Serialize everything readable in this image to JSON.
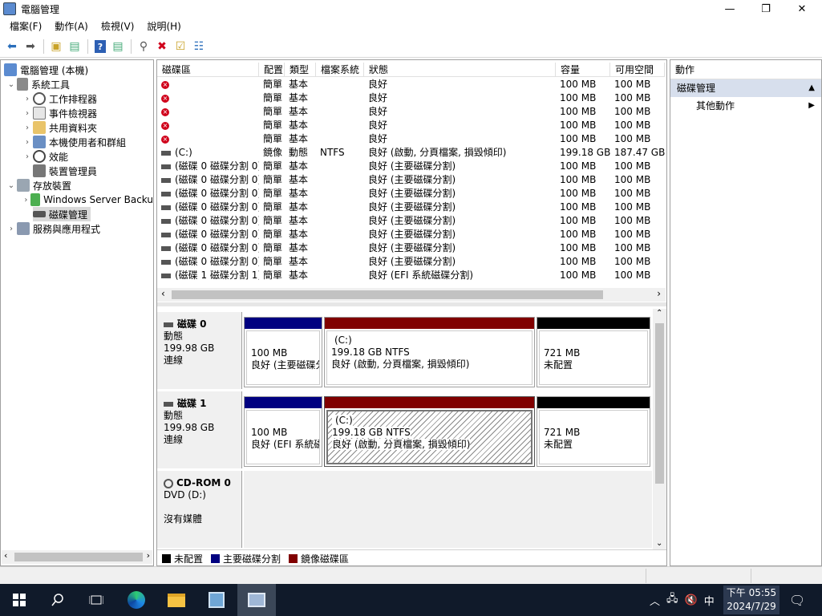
{
  "window": {
    "title": "電腦管理",
    "minimize": "—",
    "maximize": "❐",
    "close": "✕"
  },
  "menu": [
    "檔案(F)",
    "動作(A)",
    "檢視(V)",
    "說明(H)"
  ],
  "tree": {
    "root": "電腦管理 (本機)",
    "system_tools": "系統工具",
    "task_scheduler": "工作排程器",
    "event_viewer": "事件檢視器",
    "shared_folders": "共用資料夾",
    "local_users": "本機使用者和群組",
    "performance": "效能",
    "device_manager": "裝置管理員",
    "storage": "存放裝置",
    "windows_backup": "Windows Server Backu",
    "disk_management": "磁碟管理",
    "services": "服務與應用程式"
  },
  "columns": [
    "磁碟區",
    "配置",
    "類型",
    "檔案系統",
    "狀態",
    "容量",
    "可用空間"
  ],
  "volumes": [
    {
      "name": "",
      "layout": "簡單",
      "type": "基本",
      "fs": "",
      "status": "良好",
      "capacity": "100 MB",
      "free": "100 MB",
      "icon": "error"
    },
    {
      "name": "",
      "layout": "簡單",
      "type": "基本",
      "fs": "",
      "status": "良好",
      "capacity": "100 MB",
      "free": "100 MB",
      "icon": "error"
    },
    {
      "name": "",
      "layout": "簡單",
      "type": "基本",
      "fs": "",
      "status": "良好",
      "capacity": "100 MB",
      "free": "100 MB",
      "icon": "error"
    },
    {
      "name": "",
      "layout": "簡單",
      "type": "基本",
      "fs": "",
      "status": "良好",
      "capacity": "100 MB",
      "free": "100 MB",
      "icon": "error"
    },
    {
      "name": "",
      "layout": "簡單",
      "type": "基本",
      "fs": "",
      "status": "良好",
      "capacity": "100 MB",
      "free": "100 MB",
      "icon": "error"
    },
    {
      "name": "(C:)",
      "layout": "鏡像",
      "type": "動態",
      "fs": "NTFS",
      "status": "良好 (啟動, 分頁檔案, 損毀傾印)",
      "capacity": "199.18 GB",
      "free": "187.47 GB",
      "icon": "drive"
    },
    {
      "name": "(磁碟 0 磁碟分割 0)",
      "layout": "簡單",
      "type": "基本",
      "fs": "",
      "status": "良好 (主要磁碟分割)",
      "capacity": "100 MB",
      "free": "100 MB",
      "icon": "drive"
    },
    {
      "name": "(磁碟 0 磁碟分割 0)",
      "layout": "簡單",
      "type": "基本",
      "fs": "",
      "status": "良好 (主要磁碟分割)",
      "capacity": "100 MB",
      "free": "100 MB",
      "icon": "drive"
    },
    {
      "name": "(磁碟 0 磁碟分割 0)",
      "layout": "簡單",
      "type": "基本",
      "fs": "",
      "status": "良好 (主要磁碟分割)",
      "capacity": "100 MB",
      "free": "100 MB",
      "icon": "drive"
    },
    {
      "name": "(磁碟 0 磁碟分割 0)",
      "layout": "簡單",
      "type": "基本",
      "fs": "",
      "status": "良好 (主要磁碟分割)",
      "capacity": "100 MB",
      "free": "100 MB",
      "icon": "drive"
    },
    {
      "name": "(磁碟 0 磁碟分割 0)",
      "layout": "簡單",
      "type": "基本",
      "fs": "",
      "status": "良好 (主要磁碟分割)",
      "capacity": "100 MB",
      "free": "100 MB",
      "icon": "drive"
    },
    {
      "name": "(磁碟 0 磁碟分割 0)",
      "layout": "簡單",
      "type": "基本",
      "fs": "",
      "status": "良好 (主要磁碟分割)",
      "capacity": "100 MB",
      "free": "100 MB",
      "icon": "drive"
    },
    {
      "name": "(磁碟 0 磁碟分割 0)",
      "layout": "簡單",
      "type": "基本",
      "fs": "",
      "status": "良好 (主要磁碟分割)",
      "capacity": "100 MB",
      "free": "100 MB",
      "icon": "drive"
    },
    {
      "name": "(磁碟 0 磁碟分割 0)",
      "layout": "簡單",
      "type": "基本",
      "fs": "",
      "status": "良好 (主要磁碟分割)",
      "capacity": "100 MB",
      "free": "100 MB",
      "icon": "drive"
    },
    {
      "name": "(磁碟 1 磁碟分割 1)",
      "layout": "簡單",
      "type": "基本",
      "fs": "",
      "status": "良好 (EFI 系統磁碟分割)",
      "capacity": "100 MB",
      "free": "100 MB",
      "icon": "drive"
    }
  ],
  "disks": [
    {
      "name": "磁碟 0",
      "type": "動態",
      "size": "199.98 GB",
      "state": "連線",
      "p1": {
        "l1": "100 MB",
        "l2": "良好 (主要磁碟分"
      },
      "p2": {
        "l0": "(C:)",
        "l1": "199.18 GB NTFS",
        "l2": "良好 (啟動, 分頁檔案, 損毀傾印)"
      },
      "p3": {
        "l1": "721 MB",
        "l2": "未配置"
      }
    },
    {
      "name": "磁碟 1",
      "type": "動態",
      "size": "199.98 GB",
      "state": "連線",
      "p1": {
        "l1": "100 MB",
        "l2": "良好 (EFI 系統磁"
      },
      "p2": {
        "l0": "(C:)",
        "l1": "199.18 GB NTFS",
        "l2": "良好 (啟動, 分頁檔案, 損毀傾印)"
      },
      "p3": {
        "l1": "721 MB",
        "l2": "未配置"
      }
    }
  ],
  "cdrom": {
    "name": "CD-ROM 0",
    "drive": "DVD (D:)",
    "media": "沒有媒體"
  },
  "legend": {
    "unallocated": "未配置",
    "primary": "主要磁碟分割",
    "mirror": "鏡像磁碟區"
  },
  "colors": {
    "primary": "#000080",
    "mirror": "#800000",
    "unallocated": "#000000",
    "taskbar": "#101a2a"
  },
  "actions": {
    "header": "動作",
    "section": "磁碟管理",
    "more": "其他動作"
  },
  "taskbar": {
    "time": "下午 05:55",
    "date": "2024/7/29",
    "ime": "中"
  }
}
